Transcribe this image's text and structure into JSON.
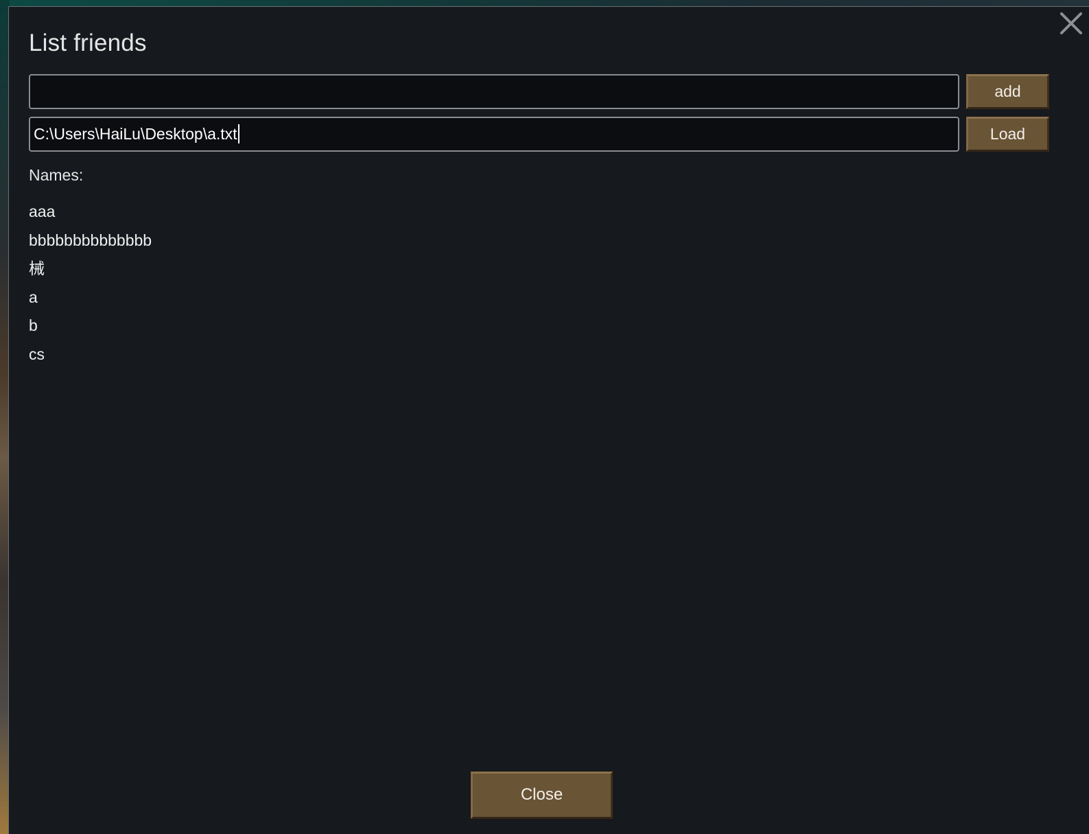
{
  "window": {
    "title": "List friends",
    "close_icon": "close-icon"
  },
  "add_row": {
    "input_value": "",
    "button_label": "add"
  },
  "load_row": {
    "input_value": "C:\\Users\\HaiLu\\Desktop\\a.txt",
    "button_label": "Load"
  },
  "names": {
    "label": "Names:",
    "items": [
      "aaa",
      "bbbbbbbbbbbbbb",
      "械",
      "a",
      "b",
      "cs"
    ]
  },
  "footer": {
    "close_label": "Close"
  },
  "colors": {
    "dialog_background": "#161a1f",
    "button_brown": "#6a5436",
    "input_background": "#0b0d10",
    "text": "#e6e6e6"
  }
}
